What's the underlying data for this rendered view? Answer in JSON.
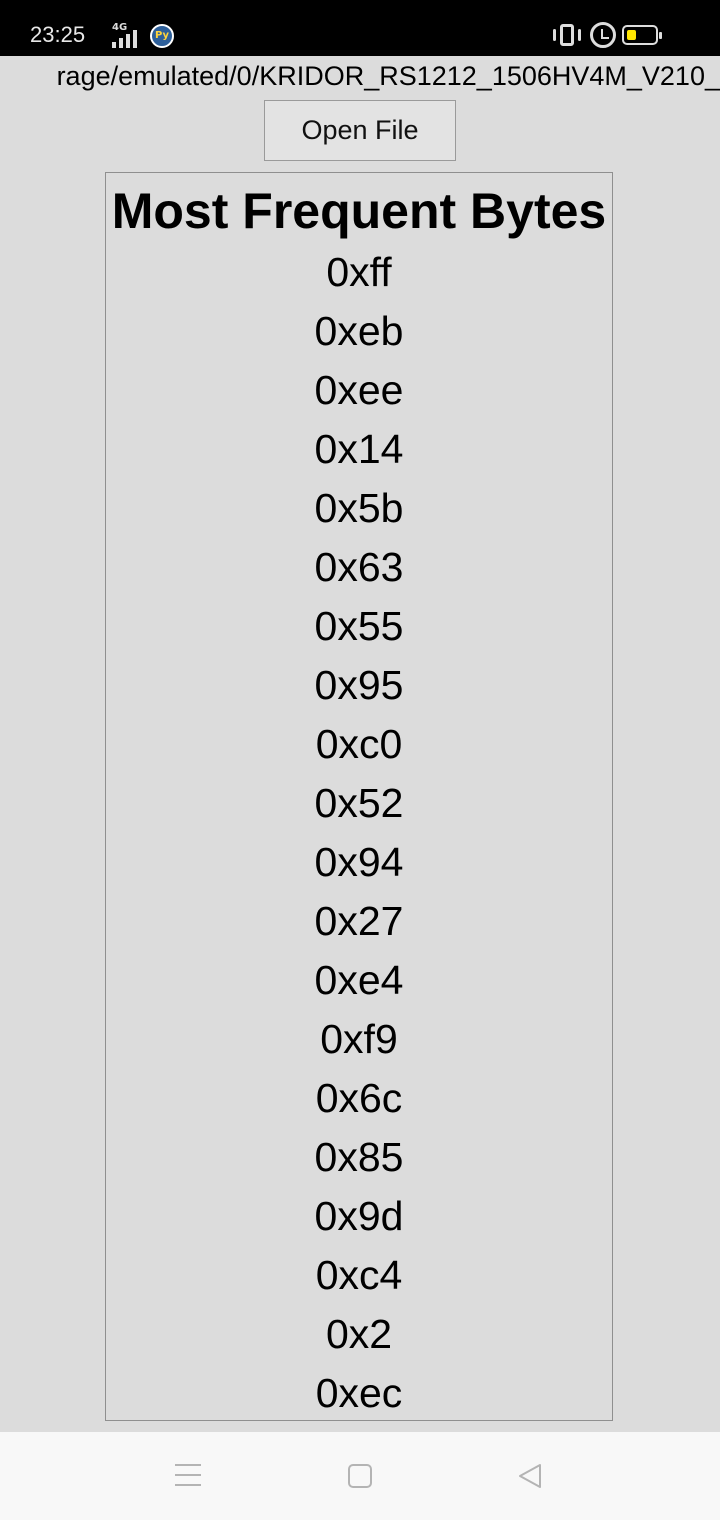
{
  "status_bar": {
    "time": "23:25",
    "network_label": "4G",
    "app_icon": "pydroid-icon",
    "right_icons": [
      "vibrate-icon",
      "alarm-icon",
      "battery-icon"
    ],
    "battery_color": "#ffe600"
  },
  "file_path": "rage/emulated/0/KRIDOR_RS1212_1506HV4M_V210_",
  "open_file_button": {
    "label": "Open File"
  },
  "bytes_panel": {
    "title": "Most Frequent Bytes",
    "items": [
      "0xff",
      "0xeb",
      "0xee",
      "0x14",
      "0x5b",
      "0x63",
      "0x55",
      "0x95",
      "0xc0",
      "0x52",
      "0x94",
      "0x27",
      "0xe4",
      "0xf9",
      "0x6c",
      "0x85",
      "0x9d",
      "0xc4",
      "0x2",
      "0xec"
    ]
  },
  "nav_bar": {
    "icons": [
      "menu-icon",
      "home-icon",
      "back-icon"
    ]
  },
  "colors": {
    "background": "#dcdcdc",
    "status_bar": "#000000",
    "nav_bar": "#f8f8f8"
  }
}
